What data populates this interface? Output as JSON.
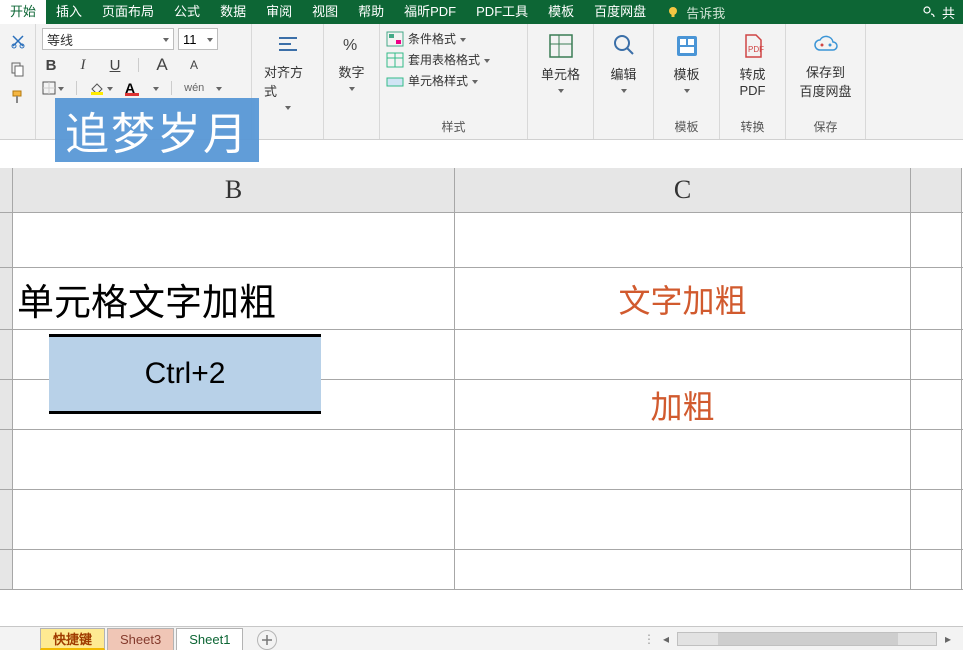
{
  "tabs": {
    "items": [
      "开始",
      "插入",
      "页面布局",
      "公式",
      "数据",
      "审阅",
      "视图",
      "帮助",
      "福昕PDF",
      "PDF工具",
      "模板",
      "百度网盘"
    ],
    "active": 0,
    "tell_me": "告诉我",
    "share": "共"
  },
  "font": {
    "family": "等线",
    "size": "11",
    "bold": "B",
    "italic": "I",
    "underline": "U",
    "grow": "A",
    "shrink": "A",
    "colorA": "A",
    "pinyin": "wén"
  },
  "groups": {
    "align": "对齐方式",
    "number": "数字",
    "styles": "样式",
    "conditional": "条件格式",
    "table_format": "套用表格格式",
    "cell_style": "单元格样式",
    "cells": "单元格",
    "editing": "编辑",
    "template": "模板",
    "convert_pdf": "转成\nPDF",
    "convert": "转换",
    "save_baidu": "保存到\n百度网盘",
    "save": "保存"
  },
  "watermark": "追梦岁月",
  "columns": {
    "B": "B",
    "C": "C"
  },
  "cells": {
    "b2": "单元格文字加粗",
    "c2": "文字加粗",
    "shortcut": "Ctrl+2",
    "c4": "加粗"
  },
  "sheets": [
    "快捷键",
    "Sheet3",
    "Sheet1"
  ]
}
